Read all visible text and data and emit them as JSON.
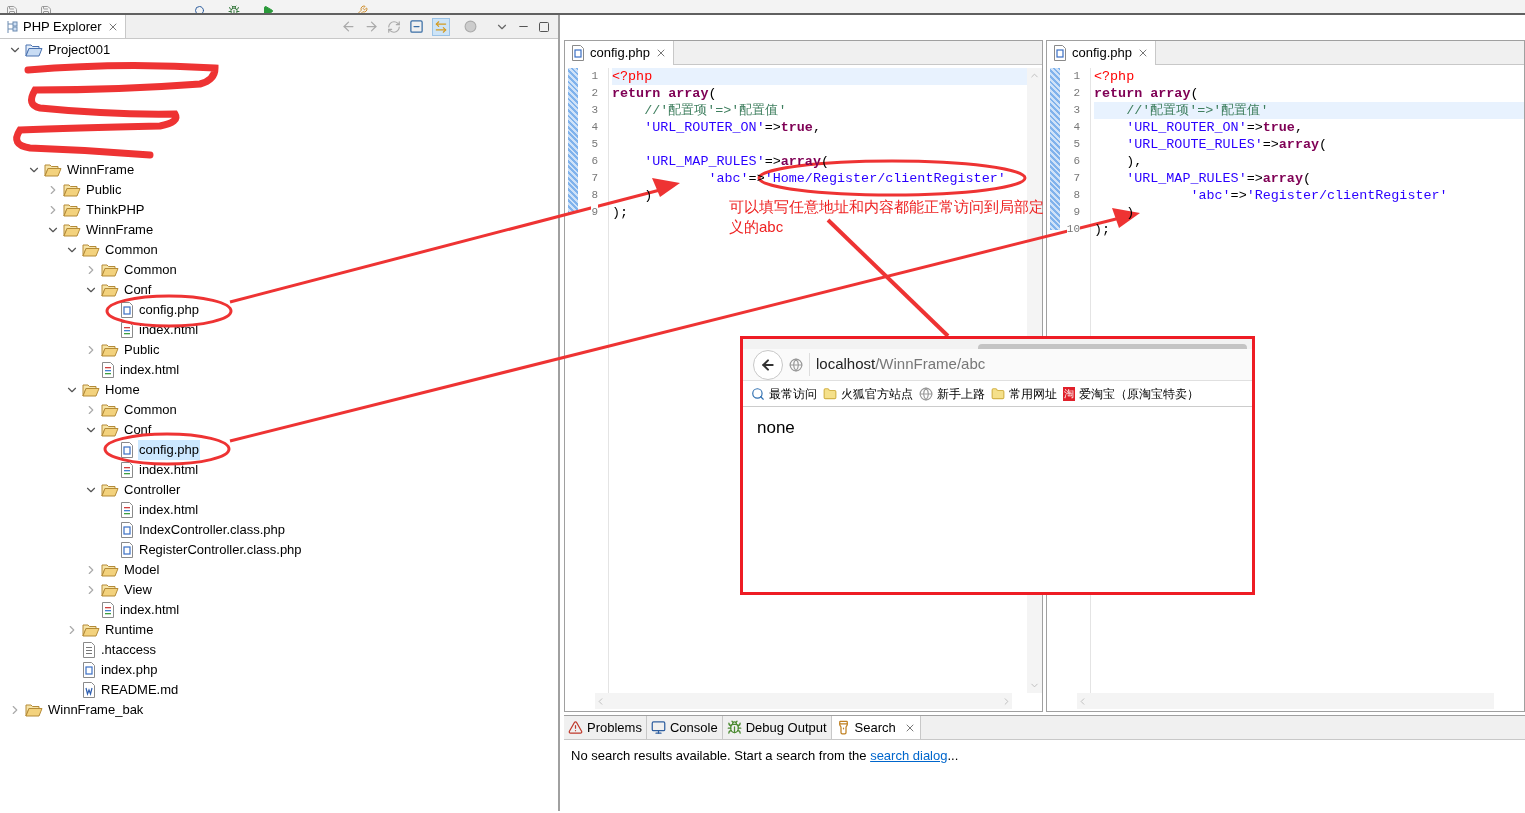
{
  "explorer": {
    "title": "PHP Explorer",
    "tree": [
      {
        "label": "Project001",
        "kind": "project",
        "expanded": true,
        "selected": false,
        "children": [
          {
            "kind": "redacted"
          },
          {
            "kind": "redacted"
          },
          {
            "kind": "redacted"
          },
          {
            "kind": "redacted"
          },
          {
            "kind": "redacted"
          },
          {
            "label": "WinnFrame",
            "kind": "folder",
            "expanded": true,
            "selected": false,
            "children": [
              {
                "label": "Public",
                "kind": "folder",
                "expanded": false,
                "selected": false
              },
              {
                "label": "ThinkPHP",
                "kind": "folder",
                "expanded": false,
                "selected": false
              },
              {
                "label": "WinnFrame",
                "kind": "folder",
                "expanded": true,
                "selected": false,
                "children": [
                  {
                    "label": "Common",
                    "kind": "folder",
                    "expanded": true,
                    "selected": false,
                    "children": [
                      {
                        "label": "Common",
                        "kind": "folder",
                        "expanded": false,
                        "selected": false
                      },
                      {
                        "label": "Conf",
                        "kind": "folder",
                        "expanded": true,
                        "selected": false,
                        "children": [
                          {
                            "label": "config.php",
                            "kind": "php",
                            "selected": false
                          },
                          {
                            "label": "index.html",
                            "kind": "html",
                            "selected": false
                          }
                        ]
                      },
                      {
                        "label": "Public",
                        "kind": "folder",
                        "expanded": false,
                        "selected": false
                      },
                      {
                        "label": "index.html",
                        "kind": "html",
                        "selected": false
                      }
                    ]
                  },
                  {
                    "label": "Home",
                    "kind": "folder",
                    "expanded": true,
                    "selected": false,
                    "children": [
                      {
                        "label": "Common",
                        "kind": "folder",
                        "expanded": false,
                        "selected": false
                      },
                      {
                        "label": "Conf",
                        "kind": "folder",
                        "expanded": true,
                        "selected": false,
                        "children": [
                          {
                            "label": "config.php",
                            "kind": "php",
                            "selected": true
                          },
                          {
                            "label": "index.html",
                            "kind": "html",
                            "selected": false
                          }
                        ]
                      },
                      {
                        "label": "Controller",
                        "kind": "folder",
                        "expanded": true,
                        "selected": false,
                        "children": [
                          {
                            "label": "index.html",
                            "kind": "html",
                            "selected": false
                          },
                          {
                            "label": "IndexController.class.php",
                            "kind": "php",
                            "selected": false
                          },
                          {
                            "label": "RegisterController.class.php",
                            "kind": "php",
                            "selected": false
                          }
                        ]
                      },
                      {
                        "label": "Model",
                        "kind": "folder",
                        "expanded": false,
                        "selected": false
                      },
                      {
                        "label": "View",
                        "kind": "folder",
                        "expanded": false,
                        "selected": false
                      },
                      {
                        "label": "index.html",
                        "kind": "html",
                        "selected": false
                      }
                    ]
                  },
                  {
                    "label": "Runtime",
                    "kind": "folder",
                    "expanded": false,
                    "selected": false
                  },
                  {
                    "label": ".htaccess",
                    "kind": "text",
                    "selected": false
                  },
                  {
                    "label": "index.php",
                    "kind": "php",
                    "selected": false
                  },
                  {
                    "label": "README.md",
                    "kind": "md",
                    "selected": false
                  }
                ]
              }
            ]
          }
        ]
      },
      {
        "label": "WinnFrame_bak",
        "kind": "folder",
        "expanded": false,
        "selected": false
      }
    ]
  },
  "editors": [
    {
      "tab": "config.php",
      "lines": [
        {
          "number": "1",
          "highlighted": true,
          "tokens": [
            {
              "kind": "tag",
              "text": "<?php"
            }
          ]
        },
        {
          "number": "2",
          "highlighted": false,
          "tokens": [
            {
              "kind": "keyword",
              "text": "return array"
            },
            {
              "kind": "plain",
              "text": "("
            }
          ]
        },
        {
          "number": "3",
          "highlighted": false,
          "tokens": [
            {
              "kind": "comment",
              "text": "    //'配置项'=>'配置值'"
            }
          ]
        },
        {
          "number": "4",
          "highlighted": false,
          "tokens": [
            {
              "kind": "string",
              "text": "    'URL_ROUTER_ON'"
            },
            {
              "kind": "plain",
              "text": "=>"
            },
            {
              "kind": "keyword",
              "text": "true"
            },
            {
              "kind": "plain",
              "text": ","
            }
          ]
        },
        {
          "number": "5",
          "highlighted": false
        },
        {
          "number": "6",
          "highlighted": false,
          "tokens": [
            {
              "kind": "string",
              "text": "    'URL_MAP_RULES'"
            },
            {
              "kind": "plain",
              "text": "=>"
            },
            {
              "kind": "keyword",
              "text": "array"
            },
            {
              "kind": "plain",
              "text": "("
            }
          ]
        },
        {
          "number": "7",
          "highlighted": false,
          "tokens": [
            {
              "kind": "string",
              "text": "            'abc'"
            },
            {
              "kind": "plain",
              "text": "=>"
            },
            {
              "kind": "string",
              "text": "'Home/Register/clientRegister'"
            }
          ]
        },
        {
          "number": "8",
          "highlighted": false,
          "tokens": [
            {
              "kind": "plain",
              "text": "    )"
            }
          ]
        },
        {
          "number": "9",
          "highlighted": false,
          "tokens": [
            {
              "kind": "plain",
              "text": ");"
            }
          ]
        }
      ]
    },
    {
      "tab": "config.php",
      "lines": [
        {
          "number": "1",
          "highlighted": false,
          "tokens": [
            {
              "kind": "tag",
              "text": "<?php"
            }
          ]
        },
        {
          "number": "2",
          "highlighted": false,
          "tokens": [
            {
              "kind": "keyword",
              "text": "return array"
            },
            {
              "kind": "plain",
              "text": "("
            }
          ]
        },
        {
          "number": "3",
          "highlighted": true,
          "tokens": [
            {
              "kind": "comment",
              "text": "    //'配置项'=>'配置值'"
            }
          ]
        },
        {
          "number": "4",
          "highlighted": false,
          "tokens": [
            {
              "kind": "string",
              "text": "    'URL_ROUTER_ON'"
            },
            {
              "kind": "plain",
              "text": "=>"
            },
            {
              "kind": "keyword",
              "text": "true"
            },
            {
              "kind": "plain",
              "text": ","
            }
          ]
        },
        {
          "number": "5",
          "highlighted": false,
          "tokens": [
            {
              "kind": "string",
              "text": "    'URL_ROUTE_RULES'"
            },
            {
              "kind": "plain",
              "text": "=>"
            },
            {
              "kind": "keyword",
              "text": "array"
            },
            {
              "kind": "plain",
              "text": "("
            }
          ]
        },
        {
          "number": "6",
          "highlighted": false,
          "tokens": [
            {
              "kind": "plain",
              "text": "    ),"
            }
          ]
        },
        {
          "number": "7",
          "highlighted": false,
          "tokens": [
            {
              "kind": "string",
              "text": "    'URL_MAP_RULES'"
            },
            {
              "kind": "plain",
              "text": "=>"
            },
            {
              "kind": "keyword",
              "text": "array"
            },
            {
              "kind": "plain",
              "text": "("
            }
          ]
        },
        {
          "number": "8",
          "highlighted": false,
          "tokens": [
            {
              "kind": "string",
              "text": "            'abc'"
            },
            {
              "kind": "plain",
              "text": "=>"
            },
            {
              "kind": "string",
              "text": "'Register/clientRegister'"
            }
          ]
        },
        {
          "number": "9",
          "highlighted": false,
          "tokens": [
            {
              "kind": "plain",
              "text": "    )"
            }
          ]
        },
        {
          "number": "10",
          "highlighted": false,
          "tokens": [
            {
              "kind": "plain",
              "text": ");"
            }
          ]
        }
      ]
    }
  ],
  "annotation": {
    "note": "可以填写任意地址和内容都能正常访问到局部定义的abc"
  },
  "browser": {
    "url_host": "localhost",
    "url_path": "/WinnFrame/abc",
    "bookmarks": [
      {
        "label": "最常访问"
      },
      {
        "label": "火狐官方站点"
      },
      {
        "label": "新手上路"
      },
      {
        "label": "常用网址"
      },
      {
        "label": "爱淘宝（原淘宝特卖）",
        "badge": "淘"
      }
    ],
    "content": "none"
  },
  "bottom_panel": {
    "tabs": [
      {
        "label": "Problems",
        "selected": false
      },
      {
        "label": "Console",
        "selected": false
      },
      {
        "label": "Debug Output",
        "selected": false
      },
      {
        "label": "Search",
        "selected": true
      }
    ],
    "message_before": "No search results available. Start a search from the ",
    "link": "search dialog",
    "message_after": "..."
  }
}
